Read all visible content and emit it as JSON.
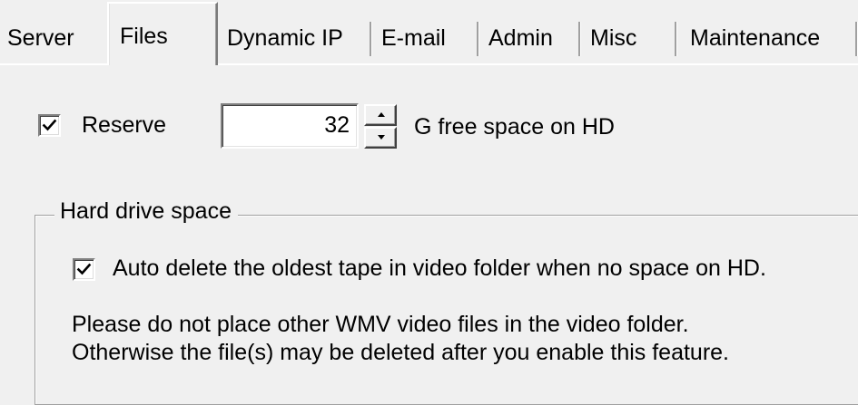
{
  "tabs": {
    "server": "Server",
    "files": "Files",
    "dynamic_ip": "Dynamic IP",
    "email": "E-mail",
    "admin": "Admin",
    "misc": "Misc",
    "maintenance": "Maintenance",
    "selected": "Files"
  },
  "reserve": {
    "checkbox_label": "Reserve",
    "checked": true,
    "value": "32",
    "suffix": "G free space on HD"
  },
  "hard_drive_group": {
    "title": "Hard drive space",
    "auto_delete_label": "Auto delete the oldest tape in video folder when no space on HD.",
    "auto_delete_checked": true,
    "note_line1": "Please do not place other WMV video files in the video folder.",
    "note_line2": "Otherwise the file(s) may be deleted after you enable this feature."
  },
  "colors": {
    "background": "#f0f0f0",
    "text": "#000000",
    "border_dark": "#808080",
    "border_light": "#ffffff"
  }
}
